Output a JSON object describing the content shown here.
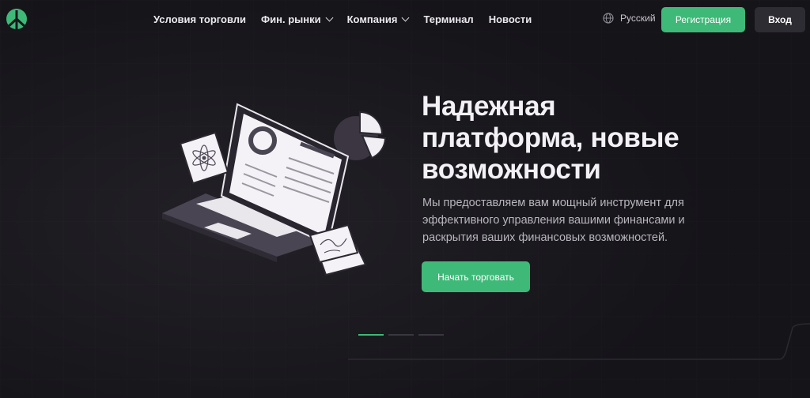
{
  "header": {
    "nav": [
      {
        "label": "Условия торговли",
        "has_dropdown": false
      },
      {
        "label": "Фин. рынки",
        "has_dropdown": true
      },
      {
        "label": "Компания",
        "has_dropdown": true
      },
      {
        "label": "Терминал",
        "has_dropdown": false
      },
      {
        "label": "Новости",
        "has_dropdown": false
      }
    ],
    "language": "Русский",
    "register_label": "Регистрация",
    "login_label": "Вход"
  },
  "hero": {
    "title": "Надежная платформа, новые возможности",
    "subtitle": "Мы предоставляем вам мощный инструмент для эффективного управления вашими финансами и раскрытия ваших финансовых возможностей.",
    "cta_label": "Начать торговать"
  },
  "slider": {
    "count": 3,
    "active_index": 0
  },
  "colors": {
    "accent": "#3fb978",
    "background": "#19181d",
    "button_dark": "#2e2c33"
  }
}
